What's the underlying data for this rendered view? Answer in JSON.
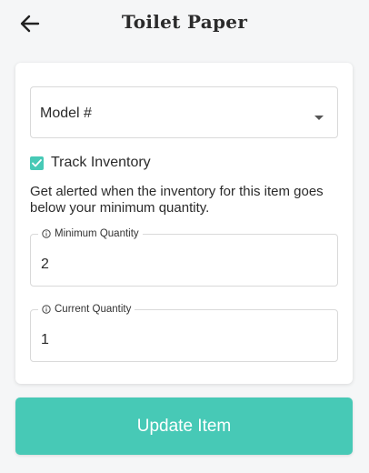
{
  "header": {
    "title": "Toilet Paper",
    "back_icon": "arrow-left-icon"
  },
  "form": {
    "model_select": {
      "value": "Model #",
      "icon": "caret-down-icon"
    },
    "track_inventory": {
      "label": "Track Inventory",
      "checked": true
    },
    "helper_text": "Get alerted when the inventory for this item goes below your minimum quantity.",
    "minimum_quantity": {
      "label": "Minimum Quantity",
      "value": "2",
      "icon": "info-icon"
    },
    "current_quantity": {
      "label": "Current Quantity",
      "value": "1",
      "icon": "info-icon"
    }
  },
  "actions": {
    "update_label": "Update Item"
  },
  "colors": {
    "accent": "#47c9b6",
    "text": "#2b2b2b",
    "border": "#d9d9d9",
    "background": "#f5f6f7"
  }
}
